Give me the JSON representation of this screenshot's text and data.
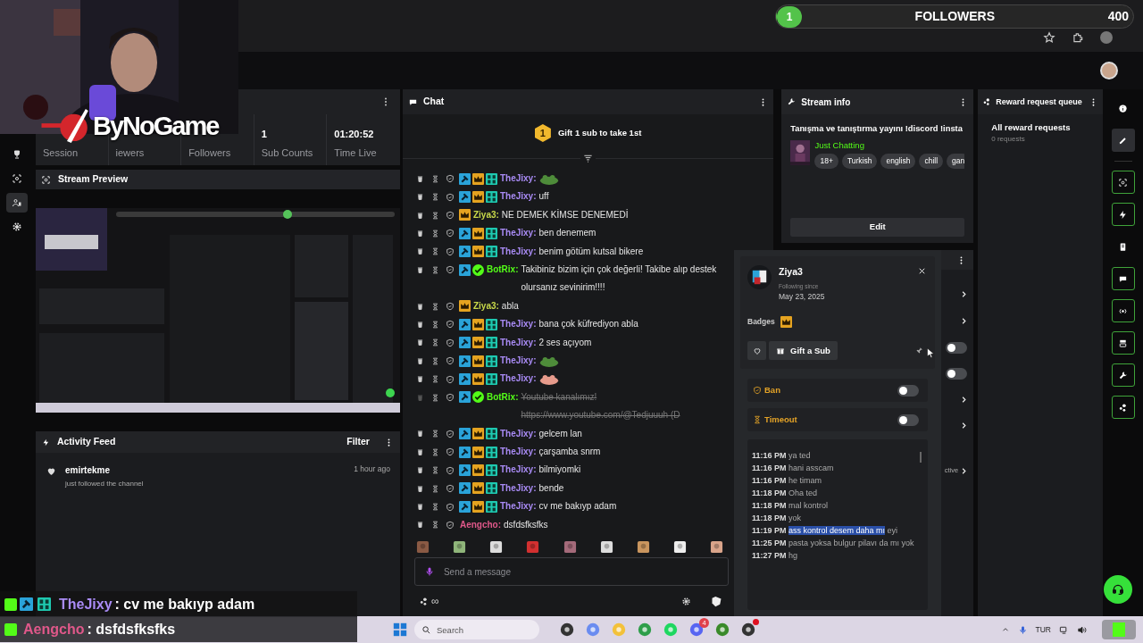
{
  "followers_goal": {
    "count": "1",
    "label": "FOLLOWERS",
    "target": "400",
    "level": 0.0025
  },
  "overlay_logo": "ByNoGame",
  "left_rail": [
    {
      "selected": false
    },
    {
      "selected": false
    },
    {
      "selected": true
    },
    {
      "selected": false
    }
  ],
  "stats": [
    {
      "label": "Session"
    },
    {
      "label": "iewers"
    },
    {
      "label": "Followers"
    },
    {
      "value": "1",
      "label": "Sub Counts"
    },
    {
      "value": "01:20:52",
      "label": "Time Live"
    }
  ],
  "stream_preview": {
    "title": "Stream Preview"
  },
  "activity_feed": {
    "title": "Activity Feed",
    "filter": "Filter",
    "events": [
      {
        "user": "emirtekme",
        "action": "just followed the channel",
        "time": "1 hour ago"
      }
    ]
  },
  "chat": {
    "title": "Chat",
    "gift_goal": {
      "rank": "1",
      "text": "Gift 1 sub to take 1st"
    },
    "messages": [
      {
        "user": "TheJixy:",
        "color": "#a98bf5",
        "moderator": true,
        "subscriber": true,
        "og": true,
        "verified": false,
        "emote": {
          "color": "#4e8c3a"
        },
        "deleted": false
      },
      {
        "user": "TheJixy:",
        "color": "#a98bf5",
        "moderator": true,
        "subscriber": true,
        "og": true,
        "verified": false,
        "text": "uff",
        "deleted": false
      },
      {
        "user": "Ziya3:",
        "color": "#c8d94a",
        "moderator": false,
        "subscriber": true,
        "og": false,
        "verified": false,
        "text": "NE DEMEK KİMSE DENEMEDİ",
        "deleted": false
      },
      {
        "user": "TheJixy:",
        "color": "#a98bf5",
        "moderator": true,
        "subscriber": true,
        "og": true,
        "verified": false,
        "text": "ben denemem",
        "deleted": false
      },
      {
        "user": "TheJixy:",
        "color": "#a98bf5",
        "moderator": true,
        "subscriber": true,
        "og": true,
        "verified": false,
        "text": "benim götüm kutsal bikere",
        "deleted": false
      },
      {
        "user": "BotRix:",
        "color": "#53fc18",
        "moderator": true,
        "subscriber": false,
        "og": false,
        "verified": true,
        "text": "Takibiniz bizim için çok değerli! Takibe alıp destek olursanız sevinirim!!!!",
        "deleted": false
      },
      {
        "user": "Ziya3:",
        "color": "#c8d94a",
        "moderator": false,
        "subscriber": true,
        "og": false,
        "verified": false,
        "text": "abla",
        "deleted": false
      },
      {
        "user": "TheJixy:",
        "color": "#a98bf5",
        "moderator": true,
        "subscriber": true,
        "og": true,
        "verified": false,
        "text": "bana çok küfrediyon abla",
        "deleted": false
      },
      {
        "user": "TheJixy:",
        "color": "#a98bf5",
        "moderator": true,
        "subscriber": true,
        "og": true,
        "verified": false,
        "text": "2 ses açıyom",
        "deleted": false
      },
      {
        "user": "TheJixy:",
        "color": "#a98bf5",
        "moderator": true,
        "subscriber": true,
        "og": true,
        "verified": false,
        "emote": {
          "color": "#4e8c3a"
        },
        "deleted": false
      },
      {
        "user": "TheJixy:",
        "color": "#a98bf5",
        "moderator": true,
        "subscriber": true,
        "og": true,
        "verified": false,
        "emote": {
          "color": "#e79b8c"
        },
        "deleted": false
      },
      {
        "user": "BotRix:",
        "color": "#53fc18",
        "moderator": true,
        "subscriber": false,
        "og": false,
        "verified": true,
        "text": "Youtube kanalımız! https://www.youtube.com/@Tedjuuuh (D",
        "deleted": true
      },
      {
        "user": "TheJixy:",
        "color": "#a98bf5",
        "moderator": true,
        "subscriber": true,
        "og": true,
        "verified": false,
        "text": "gelcem lan",
        "deleted": false
      },
      {
        "user": "TheJixy:",
        "color": "#a98bf5",
        "moderator": true,
        "subscriber": true,
        "og": true,
        "verified": false,
        "text": "çarşamba snrm",
        "deleted": false
      },
      {
        "user": "TheJixy:",
        "color": "#a98bf5",
        "moderator": true,
        "subscriber": true,
        "og": true,
        "verified": false,
        "text": "bilmiyomki",
        "deleted": false
      },
      {
        "user": "TheJixy:",
        "color": "#a98bf5",
        "moderator": true,
        "subscriber": true,
        "og": true,
        "verified": false,
        "text": "bende",
        "deleted": false
      },
      {
        "user": "TheJixy:",
        "color": "#a98bf5",
        "moderator": true,
        "subscriber": true,
        "og": true,
        "verified": false,
        "text": "cv me bakıyp adam",
        "deleted": false
      },
      {
        "user": "Aengcho:",
        "color": "#e0588a",
        "moderator": false,
        "subscriber": false,
        "og": false,
        "verified": false,
        "text": "dsfdsfksfks",
        "deleted": false
      }
    ],
    "input": {
      "placeholder": "Send a message"
    },
    "footer_count": "∞"
  },
  "stream_info": {
    "title": "Stream info",
    "stream_title": "Tanışma ve tanıştırma yayını !discord !insta",
    "category": "Just Chatting",
    "tags": [
      "18+",
      "Turkish",
      "english",
      "chill",
      "gan"
    ],
    "edit": "Edit"
  },
  "mod_panel": {
    "rows": [
      {
        "kind": "link"
      },
      {
        "kind": "link"
      },
      {
        "kind": "toggle",
        "on": false
      },
      {
        "kind": "toggle",
        "on": false
      },
      {
        "kind": "link"
      },
      {
        "kind": "link"
      },
      {
        "kind": "link",
        "label": "ctive"
      }
    ]
  },
  "reward_queue": {
    "title": "Reward request queue",
    "filter": "All reward requests",
    "count": "0 requests"
  },
  "right_rail": [
    {
      "selected": false,
      "pinned": false
    },
    {
      "selected": true,
      "pinned": false
    },
    {
      "selected": false,
      "pinned": true
    },
    {
      "selected": false,
      "pinned": true
    },
    {
      "selected": false,
      "pinned": false
    },
    {
      "selected": false,
      "pinned": true
    },
    {
      "selected": false,
      "pinned": true
    },
    {
      "selected": false,
      "pinned": true
    },
    {
      "selected": false,
      "pinned": true
    },
    {
      "selected": false,
      "pinned": true
    }
  ],
  "user_card": {
    "name": "Ziya3",
    "following_label": "Following since",
    "following_date": "May 23, 2025",
    "badges_label": "Badges",
    "gift": "Gift a Sub",
    "actions": [
      {
        "kind": "ban",
        "label": "Ban",
        "on": false
      },
      {
        "kind": "timeout",
        "label": "Timeout",
        "on": false
      }
    ],
    "history": [
      {
        "time": "11:16 PM",
        "text": "ya ted"
      },
      {
        "time": "11:16 PM",
        "text": "hani asscam"
      },
      {
        "time": "11:16 PM",
        "text": "he timam"
      },
      {
        "time": "11:18 PM",
        "text": "Oha ted"
      },
      {
        "time": "11:18 PM",
        "text": "mal kontrol"
      },
      {
        "time": "11:18 PM",
        "text": "yok"
      },
      {
        "time": "11:19 PM",
        "highlighted": "ass kontrol desem daha mı",
        "text": "eyi"
      },
      {
        "time": "11:25 PM",
        "text": "pasta yoksa bulgur pilavı da mı yok"
      },
      {
        "time": "11:27 PM",
        "text": "hg"
      }
    ]
  },
  "screen_overlay_chat": [
    {
      "user": "TheJixy",
      "color": "#a98bf5",
      "moderator": true,
      "og": true,
      "text": ": cv me bakıyp adam"
    },
    {
      "user": "Aengcho",
      "color": "#e0588a",
      "moderator": false,
      "og": false,
      "text": ": dsfdsfksfks"
    }
  ],
  "taskbar": {
    "search": {
      "placeholder": "Search"
    },
    "discord_badge": "4",
    "language": "TUR"
  }
}
